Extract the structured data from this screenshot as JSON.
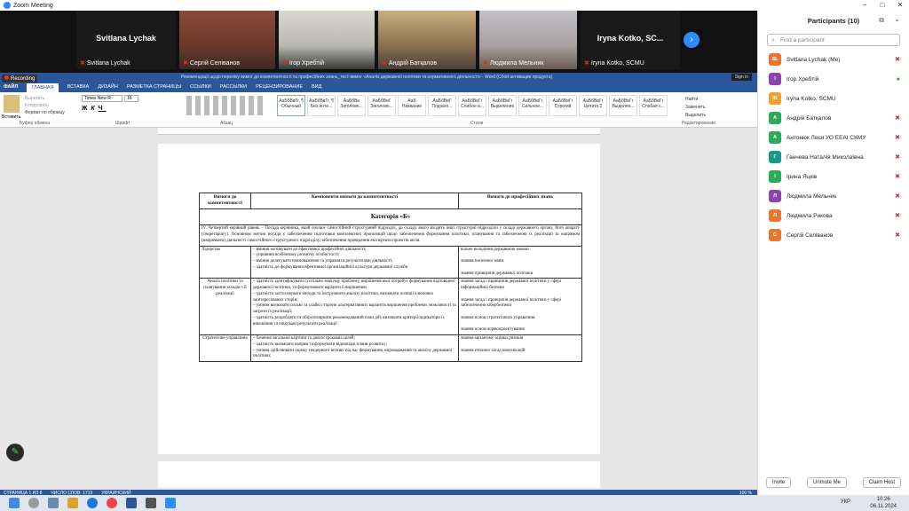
{
  "app": {
    "title": "Zoom Meeting"
  },
  "tiles": [
    {
      "name": "Svitlana Lychak",
      "caption": "Svitlana Lychak",
      "video": false
    },
    {
      "name": "",
      "caption": "Сергій Селіванов",
      "video": true
    },
    {
      "name": "",
      "caption": "Ігор Хребтій",
      "video": true
    },
    {
      "name": "",
      "caption": "Андрій Батқалов",
      "video": true
    },
    {
      "name": "",
      "caption": "Людмила Мельник",
      "video": true
    },
    {
      "name": "Iryna Kotko, SC...",
      "caption": "Iryna Kotko, SCMU",
      "video": false
    }
  ],
  "word": {
    "title": "Рекомендації щодо переліку вимог до компетентності та професійних знань_тест вимог «Аналіз державної політики та нормативного діяльності» - Word (Сбой активации продукта)",
    "recording": "Recording",
    "signin": "Sign in",
    "tabs": [
      "ФАЙЛ",
      "ГЛАВНАЯ",
      "ВСТАВКА",
      "ДИЗАЙН",
      "РАЗМЕТКА СТРАНИЦЫ",
      "ССЫЛКИ",
      "РАССЫЛКИ",
      "РЕЦЕНЗИРОВАНИЕ",
      "ВИД"
    ],
    "groups": {
      "clipboard": "Буфер обмена",
      "font": "Шрифт",
      "para": "Абзац",
      "styles": "Стили",
      "edit": "Редактирование"
    },
    "clip": {
      "paste": "Вставить",
      "cut": "Вырезать",
      "copy": "Копировать",
      "fmt": "Формат по образцу"
    },
    "font_name": "Times New R",
    "font_size": "16",
    "styles": [
      "АаБбВвГг, ¶ Обычный",
      "АаБбВвГг, ¶ Без инте...",
      "АаБбВе Заголово...",
      "АаБбВвГ Заголово...",
      "АаБ Название",
      "АаБбВвГ Подзаго...",
      "АаБбВеГг Слабое в...",
      "АаБбВвГг Выделение",
      "АаБбВвГг Сильное...",
      "АаБбВвГг Строгий",
      "АаБбВвГг Цитата 2",
      "АаБбВвГг Выделен...",
      "АаБбВвГг Слабая с...",
      "АаБбВвГг Сильная..."
    ],
    "edit": {
      "find": "Найти",
      "replace": "Заменить",
      "select": "Выделить"
    },
    "table": {
      "h1": "Вимоги до компетентності",
      "h2": "Компоненти вимоги до компетентності",
      "h3": "Вимоги до професійних знань",
      "category": "Категорія «Б»",
      "intro": "IV. Четвертий керівний рівень – Посада керівника, який очолює самостійний структурний підрозділ, до складу якого входять інші структурні підрозділи у складі державного органу, його апарату (секретаріату). Основною метою посади є забезпечення підготовки комплексних пропозицій щодо забезпечення формування політики, планування та забезпечення їх реалізації за напрямом (напрямами) діяльності самостійного структурного підрозділу, забезпечення проведення експертизи проектів актів.",
      "rows": [
        {
          "req": "Лідерство",
          "comp": "– вміння мотивувати до ефективної професійної діяльності;\n– сприяння всебічному розвитку особистості;\n– вміння делегувати повноваження та управляти результатами діяльності;\n– здатність до формування ефективної організаційної культури державної служби",
          "know": "вільне володіння державною мовою\n\nзнання іноземної мови\n\nзнання принципів державної політики"
        },
        {
          "req": "Аналіз політики та планування заходів з її реалізації",
          "comp": "– здатність ідентифікувати суспільно значущу проблему, вирішення якої потребує формування відповідної державної політики, та формулювати варіанти її вирішення;\n– здатність застосовувати методи та інструменти аналізу політики, визначати позиції ключових заінтересованих сторін;\n– уміння визначати сильні та слабкі сторони альтернативних варіантів вирішення проблеми, можливості та загрози їх реалізації;\n– здатність розробляти та обґрунтовувати рекомендований план дій, визначати критерії/індикатори їх виконання та очікувані результати реалізації",
          "know": "знання засад і принципів державної політики у сфері інформаційної безпеки\n\nзнання засад і принципів державної політики у сфері забезпечення кібербезпеки\n\nзнання основ стратегічного управління\n\nзнання основ нормопроектування"
        },
        {
          "req": "Стратегічне управління",
          "comp": "– бачення загальної картини та довгострокових цілей;\n– здатність визначати напрям та формувати відповідні плани розвитку;\n– уміння здійснювати оцінку гендерного впливу під час формування, впровадження та аналізу державної політики;",
          "know": "знання механізму оцінки ризиків\n\nзнання етичних засад комунікацій"
        }
      ]
    },
    "status": {
      "page": "СТРАНИЦА 1 ИЗ 8",
      "words": "ЧИСЛО СЛОВ: 1719",
      "lang": "УКРАИНСКИЙ",
      "zoom": "100 %"
    }
  },
  "panel": {
    "title": "Participants (10)",
    "search_placeholder": "Find a participant",
    "participants": [
      {
        "initials": "SL",
        "name": "Svitlana Lychak (Me)",
        "color": "#e8772e",
        "mic": "muted"
      },
      {
        "initials": "І",
        "name": "Ігор Хребтій",
        "color": "#8e44ad",
        "mic": "on"
      },
      {
        "initials": "IK",
        "name": "Iryna Kotko, SCMU",
        "color": "#f0a030",
        "mic": "none"
      },
      {
        "initials": "А",
        "name": "Андрій Батқалов",
        "color": "#2eaa5a",
        "mic": "muted"
      },
      {
        "initials": "А",
        "name": "Антонюк Леся УО ЕЕАІ СКМУ",
        "color": "#2eaa5a",
        "mic": "muted"
      },
      {
        "initials": "Г",
        "name": "Ганчева Наталія Миколаївна",
        "color": "#1a9a8a",
        "mic": "muted"
      },
      {
        "initials": "І",
        "name": "Ірина Яцків",
        "color": "#2eaa5a",
        "mic": "muted"
      },
      {
        "initials": "Л",
        "name": "Людмила Мельник",
        "color": "#8e44ad",
        "mic": "muted"
      },
      {
        "initials": "Л",
        "name": "Людмила Рикова",
        "color": "#e8772e",
        "mic": "muted"
      },
      {
        "initials": "С",
        "name": "Сергій Селіванов",
        "color": "#e8772e",
        "mic": "muted"
      }
    ],
    "buttons": {
      "invite": "Invite",
      "mute_me": "Unmute Me",
      "claim": "Claim Host"
    }
  },
  "taskbar": {
    "lang": "УКР",
    "time": "10:26",
    "date": "06.11.2024"
  }
}
